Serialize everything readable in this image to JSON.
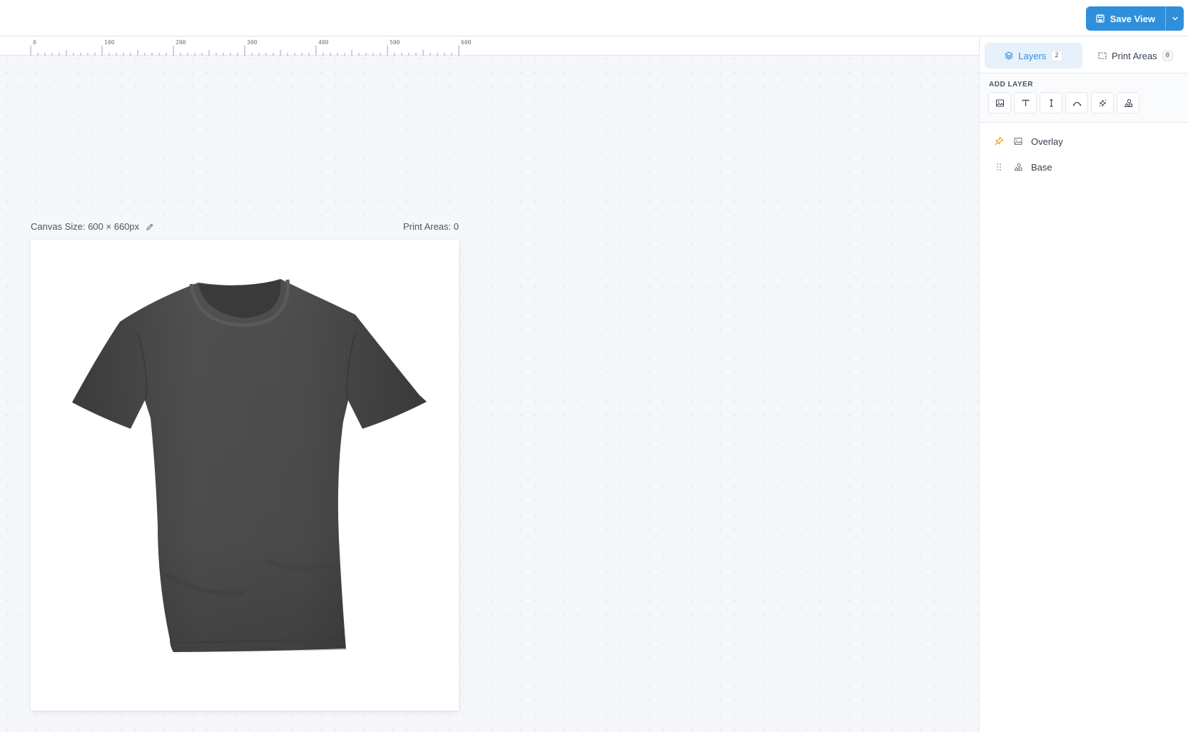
{
  "toolbar": {
    "save_label": "Save View"
  },
  "ruler": {
    "labels": [
      "0",
      "100",
      "200",
      "300",
      "400",
      "500",
      "600"
    ]
  },
  "canvas": {
    "size_label": "Canvas Size: 600 × 660px",
    "print_areas_label": "Print Areas: 0",
    "image_subject": "dark gray t-shirt mockup"
  },
  "panel": {
    "tabs": [
      {
        "label": "Layers",
        "count": "2",
        "icon": "layers-icon",
        "active": true
      },
      {
        "label": "Print Areas",
        "count": "0",
        "icon": "dashed-rect-icon",
        "active": false
      }
    ],
    "add_layer": {
      "title": "ADD LAYER",
      "buttons": [
        "image-icon",
        "text-icon",
        "text-cursor-icon",
        "curve-text-icon",
        "sparkle-icon",
        "shapes-icon"
      ]
    },
    "layers": [
      {
        "name": "Overlay",
        "lead_icon": "pin-icon",
        "type_icon": "image-icon"
      },
      {
        "name": "Base",
        "lead_icon": "drag-handle-icon",
        "type_icon": "shapes-icon"
      }
    ]
  },
  "colors": {
    "accent": "#2f8fdc",
    "accent_bg": "#e6f1fc",
    "pin": "#f59e0b",
    "shirt": "#4a4a4a"
  }
}
